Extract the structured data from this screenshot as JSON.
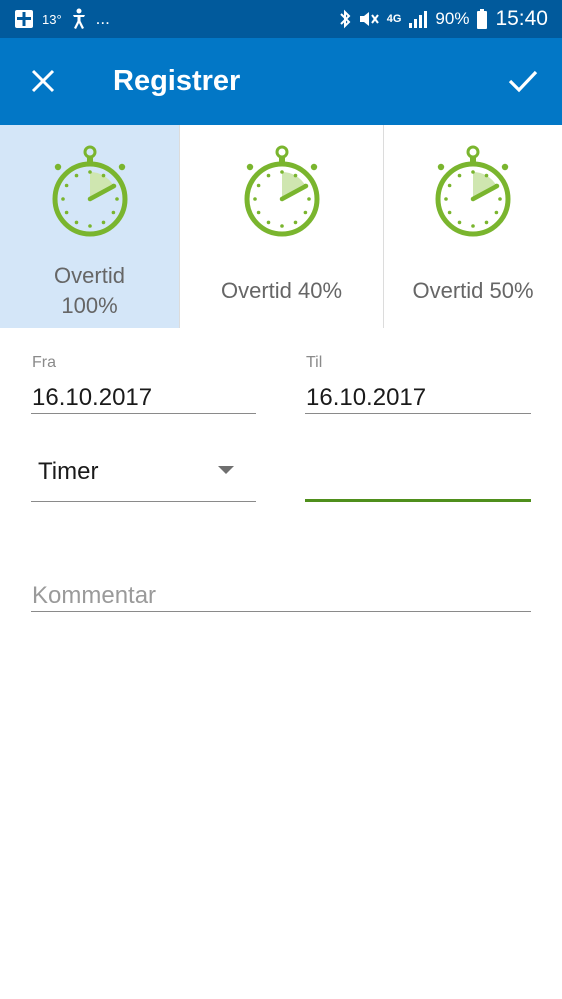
{
  "status_bar": {
    "temperature": "13°",
    "more": "...",
    "network": "4G",
    "battery": "90%",
    "time": "15:40"
  },
  "app_bar": {
    "title": "Registrer",
    "close_icon": "close-icon",
    "confirm_icon": "checkmark-icon"
  },
  "tiles": [
    {
      "label_line1": "Overtid",
      "label_line2": "100%",
      "selected": true
    },
    {
      "label": "Overtid 40%",
      "selected": false
    },
    {
      "label": "Overtid 50%",
      "selected": false
    }
  ],
  "form": {
    "fra": {
      "label": "Fra",
      "value": "16.10.2017"
    },
    "til": {
      "label": "Til",
      "value": "16.10.2017"
    },
    "unit_select": {
      "value": "Timer"
    },
    "amount": {
      "value": ""
    },
    "comment": {
      "placeholder": "Kommentar"
    }
  },
  "colors": {
    "status_bar": "#015a9c",
    "app_bar": "#0277c6",
    "selected_tile": "#d4e6f8",
    "stopwatch_green": "#7ab52e",
    "active_underline": "#4f8f1c"
  }
}
